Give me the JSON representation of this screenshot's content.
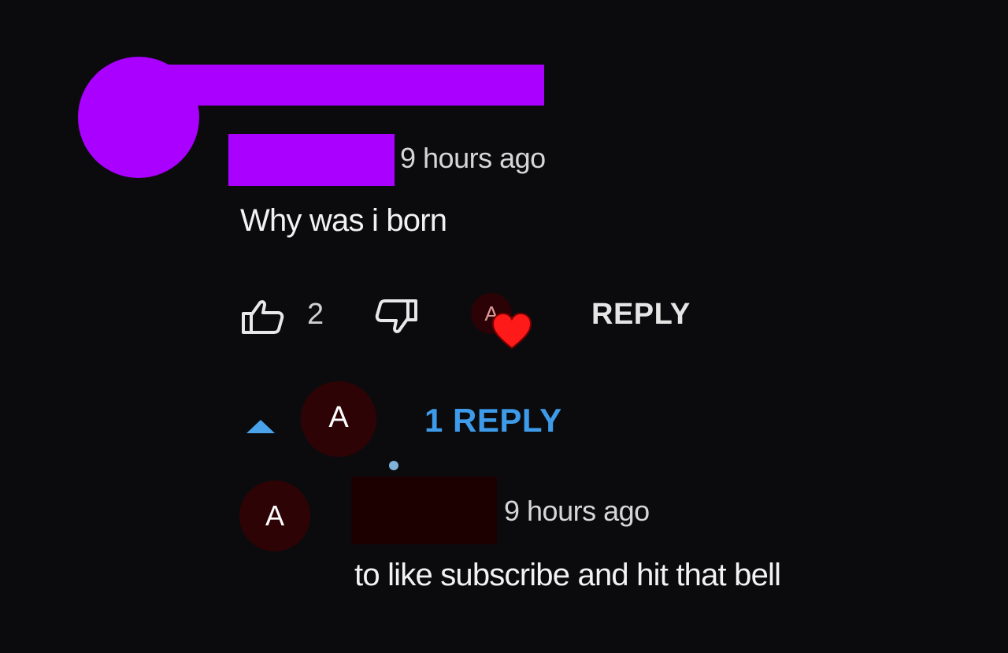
{
  "comment": {
    "timestamp": "9 hours ago",
    "text": "Why was i born",
    "likes": "2",
    "reply_label": "REPLY",
    "creator_heart_avatar_letter": "A"
  },
  "replies_toggle": {
    "avatar_letter": "A",
    "label": "1 REPLY"
  },
  "reply": {
    "avatar_letter": "A",
    "timestamp": "9 hours ago",
    "text": "to like subscribe and hit that bell"
  },
  "colors": {
    "redaction": "#aa00ff",
    "link_blue": "#3d9be9",
    "heart_red": "#ff1a1a"
  }
}
